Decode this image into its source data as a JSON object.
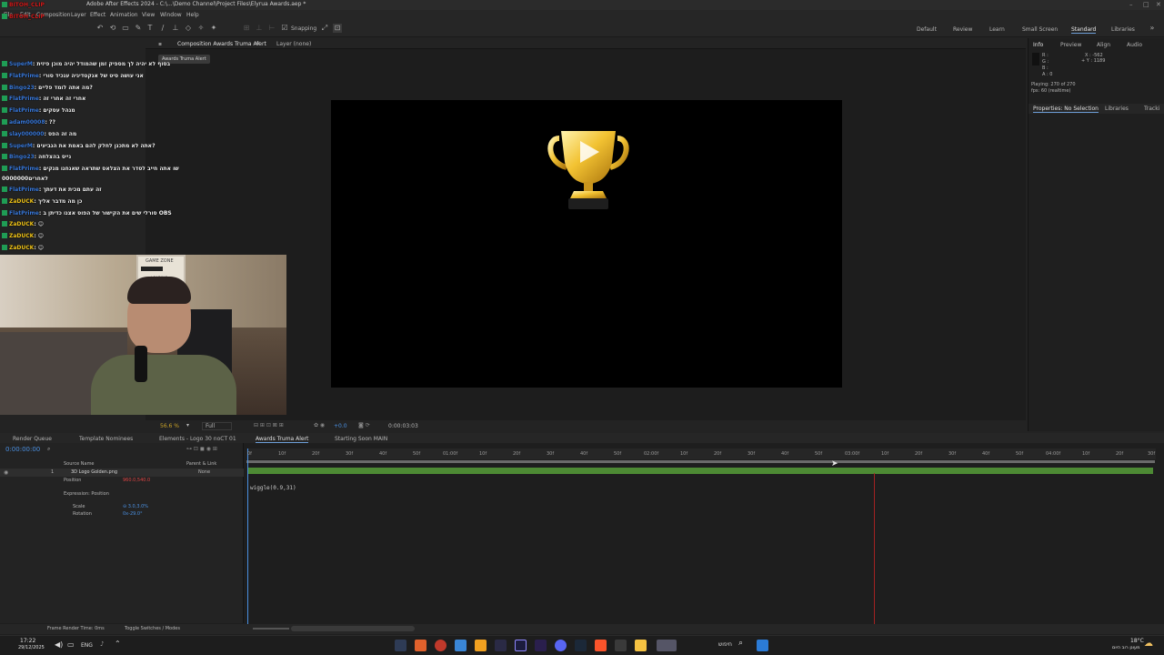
{
  "window": {
    "title": "Adobe After Effects 2024 - C:\\...\\Demo Channel\\Project Files\\Elyrua Awards.aep *",
    "controls": [
      "–",
      "□",
      "✕"
    ]
  },
  "menu": [
    "File",
    "Edit",
    "Composition",
    "Layer",
    "Effect",
    "Animation",
    "View",
    "Window",
    "Help"
  ],
  "toolbar": {
    "snapping_label": "Snapping",
    "workspaces": [
      "Default",
      "Review",
      "Learn",
      "Small Screen",
      "Standard",
      "Libraries"
    ],
    "active_workspace": "Standard"
  },
  "comp_panel": {
    "tab_label": "Composition Awards Truma Alert",
    "layer_tab": "Layer (none)",
    "breadcrumb_chip": "Awards Truma Alert",
    "footer": {
      "zoom": "56.6 %",
      "resolution": "Full",
      "timecode": "0:00:03:03"
    }
  },
  "right_panel": {
    "top_tabs": [
      "Info",
      "Preview",
      "Align",
      "Audio"
    ],
    "info_rgb": [
      "R :",
      "G :",
      "B :",
      "A : 0"
    ],
    "info_xy": [
      "X : -562",
      "+ Y : 1189"
    ],
    "playing": "Playing: 270 of 270",
    "fps": "fps: 60 (realtime)",
    "bottom_tabs": [
      "Properties: No Selection",
      "Libraries",
      "Tracki"
    ]
  },
  "timeline": {
    "tabs": [
      "Render Queue",
      "Template Nominees",
      "Elements - Logo 30 noCT 01",
      "Awards Truma Alert",
      "Starting Soon MAIN"
    ],
    "active_tab": "Awards Truma Alert",
    "current_time": "0:00:00:00",
    "columns": {
      "source_name": "Source Name",
      "parent": "Parent & Link"
    },
    "layer": {
      "index": "1",
      "name": "3D Logo Golden.png",
      "parent": "None"
    },
    "properties": [
      {
        "name": "Position",
        "value": "960.0,540.0"
      },
      {
        "name": "Expression: Position",
        "value": ""
      },
      {
        "name": "Scale",
        "value": "⊖ 3.0,3.0%"
      },
      {
        "name": "Rotation",
        "value": "0x-29.0°"
      }
    ],
    "expression": "wiggle(0.9,31)",
    "ruler_ticks": [
      "0f",
      "10f",
      "20f",
      "30f",
      "40f",
      "50f",
      "01:00f",
      "10f",
      "20f",
      "30f",
      "40f",
      "50f",
      "02:00f",
      "10f",
      "20f",
      "30f",
      "40f",
      "50f",
      "03:00f",
      "10f",
      "20f",
      "30f",
      "40f",
      "50f",
      "04:00f",
      "10f",
      "20f",
      "30f"
    ],
    "bottom_left": "Frame Render Time: 0ms",
    "toggle_label": "Toggle Switches / Modes"
  },
  "chat": [
    {
      "user": "BITOH_CLIP",
      "msg": "",
      "color": "red"
    },
    {
      "user": "BITOH_CLIP",
      "msg": "",
      "color": "red"
    },
    {
      "user": "SuperM",
      "msg": ": בסוף לא יהיה לך מספיק זמן שהמודל יהיה מוכן פיזית",
      "color": "blue"
    },
    {
      "user": "FlatPrime",
      "msg": ": אני עושה סיט של אנקטדיגיה ענכיד סורי",
      "color": "blue"
    },
    {
      "user": "Bingo23",
      "msg": ": מה אתה לומד פליים?",
      "color": "blue"
    },
    {
      "user": "FlatPrime",
      "msg": ": אחרי זה אחרי זה",
      "color": "blue"
    },
    {
      "user": "FlatPrime",
      "msg": ": מנהל עסקים",
      "color": "blue"
    },
    {
      "user": "adam00008",
      "msg": ": ??",
      "color": "blue"
    },
    {
      "user": "slay000000",
      "msg": ": מה זה הפס",
      "color": "blue"
    },
    {
      "user": "SuperM",
      "msg": ": אתה לא מתכנן לחלק להם באמת את הגביעים?",
      "color": "blue"
    },
    {
      "user": "Bingo23",
      "msg": ": נייס בהצלחה",
      "color": "blue"
    },
    {
      "user": "FlatPrime",
      "msg": ": שו אתה חייב לסדר את הצלאס שתראה שאנחנו מנקים",
      "color": "blue"
    },
    {
      "user": "",
      "msg": "לאחרים0000000",
      "color": "white"
    },
    {
      "user": "FlatPrime",
      "msg": ": זה עתם מכית את דעתך",
      "color": "blue"
    },
    {
      "user": "ZaDUCK",
      "msg": ": כן מה מדבר אליך",
      "color": "yellow"
    },
    {
      "user": "FlatPrime",
      "msg": ": סורלי שים את הקישור של הפוס אצנו כדיתן ב OBS",
      "color": "blue"
    },
    {
      "user": "ZaDUCK",
      "msg": ": 😊",
      "color": "yellow"
    },
    {
      "user": "ZaDUCK",
      "msg": ": 😊",
      "color": "yellow"
    },
    {
      "user": "ZaDUCK",
      "msg": ": 😊",
      "color": "yellow"
    }
  ],
  "webcam": {
    "sign_line1": "GAME ZONE",
    "sign_line2": "LOADING"
  },
  "taskbar": {
    "time": "17:22",
    "date": "29/12/2025",
    "lang": "ENG",
    "search_placeholder": "חיפוש",
    "weather_temp": "18°C",
    "weather_desc": "מעונן רוב היום"
  }
}
